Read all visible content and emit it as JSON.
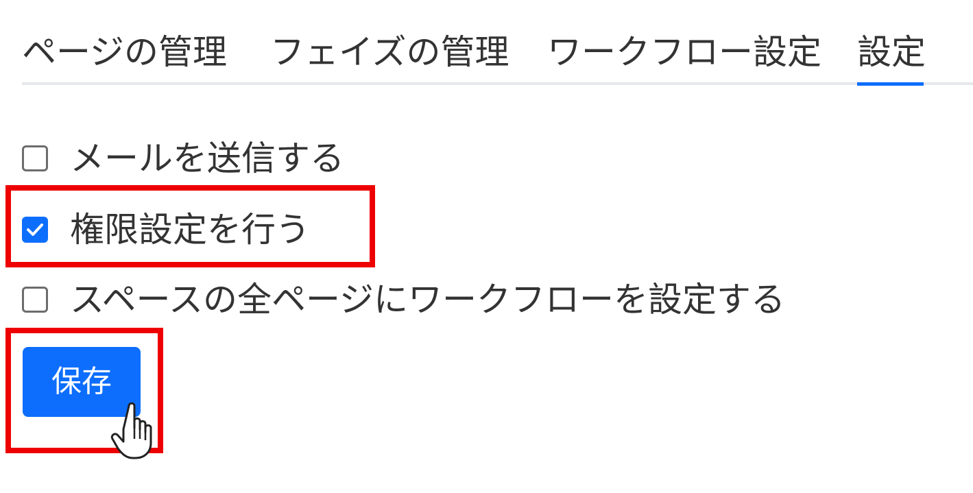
{
  "tabs": [
    {
      "label": "ページの管理",
      "active": false
    },
    {
      "label": "フェイズの管理",
      "active": false
    },
    {
      "label": "ワークフロー設定",
      "active": false
    },
    {
      "label": "設定",
      "active": true
    }
  ],
  "options": [
    {
      "label": "メールを送信する",
      "checked": false
    },
    {
      "label": "権限設定を行う",
      "checked": true
    },
    {
      "label": "スペースの全ページにワークフローを設定する",
      "checked": false
    }
  ],
  "save_button": {
    "label": "保存"
  },
  "colors": {
    "accent": "#0d6efd",
    "highlight": "#ee0000",
    "text": "#333333"
  },
  "icons": {
    "checkmark": "checkmark-icon",
    "cursor": "hand-pointer-icon"
  }
}
